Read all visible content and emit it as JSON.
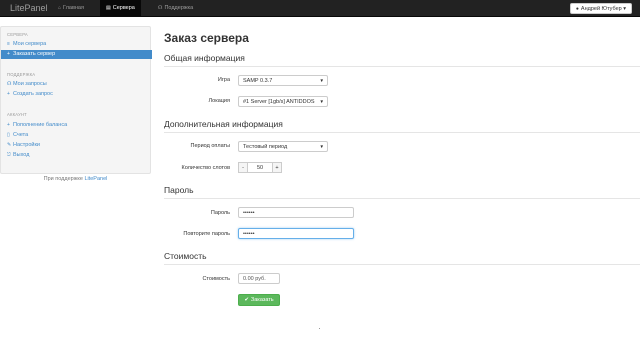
{
  "navbar": {
    "brand": "LitePanel",
    "items": [
      {
        "label": "Главная",
        "icon": "home-icon"
      },
      {
        "label": "Сервера",
        "icon": "server-icon"
      },
      {
        "label": "Поддержка",
        "icon": "headphones-icon"
      }
    ],
    "user_label": "Андрей Ютубер",
    "active_color": "#080808"
  },
  "sidebar": {
    "servers_header": "СЕРВЕРА",
    "my_servers": "Мои сервера",
    "order_server": "Заказать сервер",
    "support_header": "ПОДДЕРЖКА",
    "my_requests": "Мои запросы",
    "create_request": "Создать запрос",
    "account_header": "АККАУНТ",
    "top_up": "Пополнение баланса",
    "invoices": "Счета",
    "settings": "Настройки",
    "logout": "Выход",
    "footer_text": "При поддержке",
    "footer_link": "LitePanel",
    "active_color": "#428bca"
  },
  "page": {
    "title": "Заказ сервера",
    "general": {
      "title": "Общая информация",
      "game_label": "Игра",
      "game_value": "SAMP 0.3.7",
      "location_label": "Локация",
      "location_value": "#1 Server [1gb/s] ANTIDDOS"
    },
    "additional": {
      "title": "Дополнительная информация",
      "period_label": "Период оплаты",
      "period_value": "Тестовый период",
      "slots_label": "Количество слотов",
      "slots_minus": "-",
      "slots_value": "50",
      "slots_plus": "+"
    },
    "password": {
      "title": "Пароль",
      "password_label": "Пароль",
      "password_value": "••••••",
      "repeat_label": "Повторите пароль",
      "repeat_value": "••••••"
    },
    "cost": {
      "title": "Стоимость",
      "cost_label": "Стоимость",
      "cost_placeholder": "0.00 руб."
    },
    "order_button": "Заказать",
    "button_color": "#5cb85c"
  }
}
